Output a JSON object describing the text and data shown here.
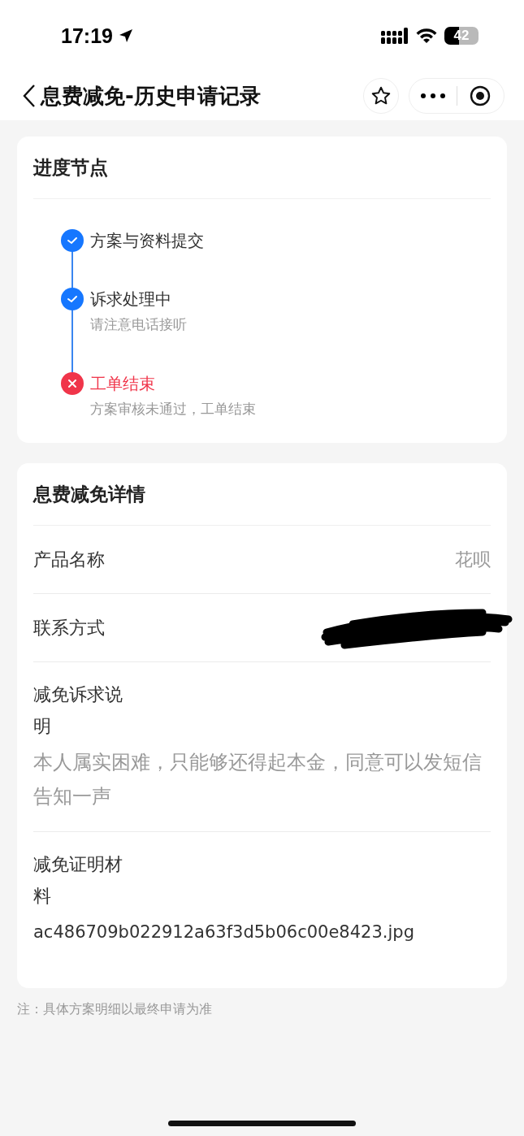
{
  "status_bar": {
    "time": "17:19",
    "battery": "42"
  },
  "nav": {
    "title": "息费减免-历史申请记录"
  },
  "progress": {
    "title": "进度节点",
    "steps": [
      {
        "label": "方案与资料提交",
        "failed": false
      },
      {
        "label": "诉求处理中",
        "note": "请注意电话接听",
        "failed": false
      },
      {
        "label": "工单结束",
        "note": "方案审核未通过，工单结束",
        "failed": true
      }
    ]
  },
  "details": {
    "title": "息费减免详情",
    "rows": [
      {
        "kind": "inline",
        "label": "产品名称",
        "value": "花呗"
      },
      {
        "kind": "redacted",
        "label": "联系方式"
      },
      {
        "kind": "block",
        "label": "减免诉求说明",
        "value": "本人属实困难，只能够还得起本金，同意可以发短信告知一声"
      },
      {
        "kind": "block",
        "label": "减免证明材料",
        "value": "ac486709b022912a63f3d5b06c00e8423.jpg"
      }
    ]
  },
  "footnote": "注：具体方案明细以最终申请为准"
}
